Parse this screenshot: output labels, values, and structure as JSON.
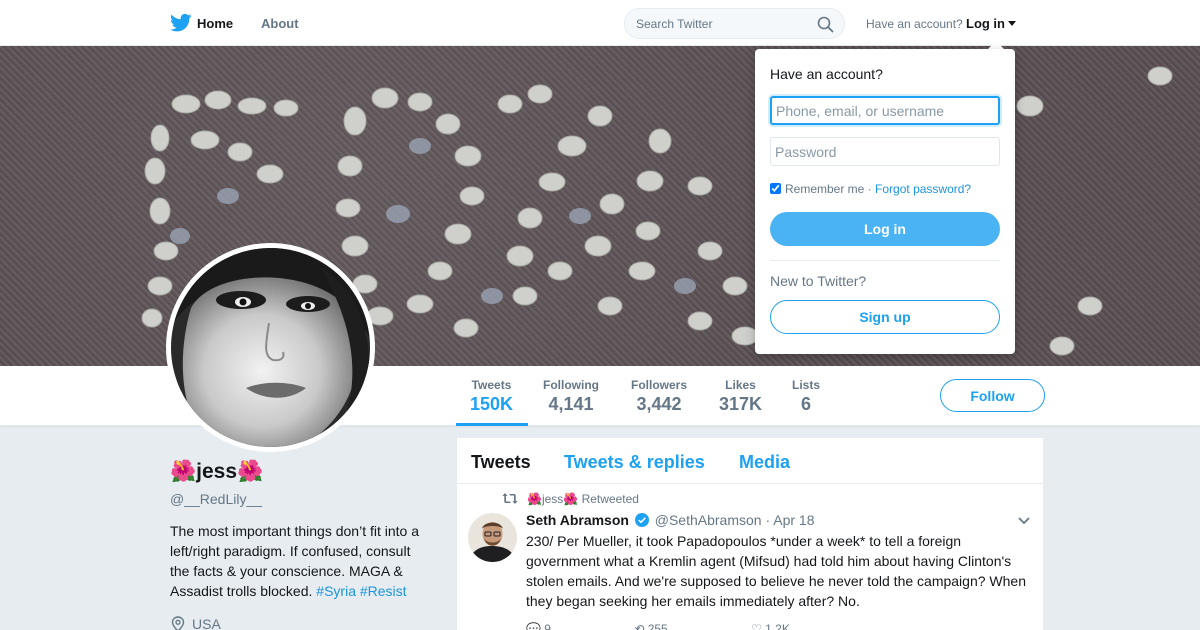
{
  "nav": {
    "home_label": "Home",
    "about_label": "About",
    "search_placeholder": "Search Twitter",
    "have_account_text": "Have an account?",
    "login_label": "Log in",
    "brand_color": "#1da1f2"
  },
  "profile": {
    "name": "🌺jess🌺",
    "handle": "@__RedLily__",
    "bio_text": "The most important things don’t fit into a left/right paradigm. If confused, consult the facts & your conscience. MAGA & Assadist trolls blocked. ",
    "bio_hashtags": [
      "#Syria",
      "#Resist"
    ],
    "location": "USA",
    "follow_label": "Follow"
  },
  "stats": [
    {
      "label": "Tweets",
      "value": "150K"
    },
    {
      "label": "Following",
      "value": "4,141"
    },
    {
      "label": "Followers",
      "value": "3,442"
    },
    {
      "label": "Likes",
      "value": "317K"
    },
    {
      "label": "Lists",
      "value": "6"
    }
  ],
  "timeline": {
    "tabs": [
      {
        "label": "Tweets"
      },
      {
        "label": "Tweets & replies"
      },
      {
        "label": "Media"
      }
    ],
    "tweet": {
      "retweeted_by": "🌺jess🌺",
      "retweeted_label": "Retweeted",
      "author_name": "Seth Abramson",
      "author_handle": "@SethAbramson",
      "separator": "·",
      "date": "Apr 18",
      "text": "230/ Per Mueller, it took Papadopoulos *under a week* to tell a foreign government what a Kremlin agent (Mifsud) had told him about having Clinton's stolen emails. And we're supposed to believe he never told the campaign? When they began seeking her emails immediately after? No.",
      "reply_count": "9",
      "retweet_count": "255",
      "like_count": "1.2K"
    }
  },
  "login_dropdown": {
    "title": "Have an account?",
    "username_placeholder": "Phone, email, or username",
    "password_placeholder": "Password",
    "remember_label": "Remember me",
    "separator": "·",
    "forgot_label": "Forgot password?",
    "login_button": "Log in",
    "new_text": "New to Twitter?",
    "signup_button": "Sign up"
  }
}
